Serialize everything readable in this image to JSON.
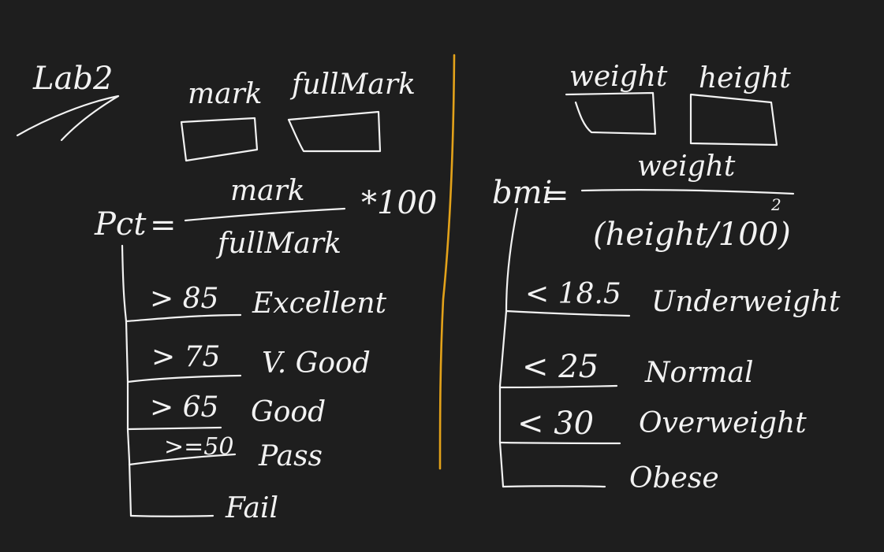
{
  "colors": {
    "background": "#1e1e1e",
    "ink": "#f2f2f2",
    "divider": "#e3a21a"
  },
  "title": "Lab2",
  "left": {
    "inputs": [
      "mark",
      "fullMark"
    ],
    "formula": {
      "lhs": "Pct",
      "eq": "=",
      "numerator": "mark",
      "denominator": "fullMark",
      "multiplier": "*100"
    },
    "branches": [
      {
        "condition": "> 85",
        "result": "Excellent"
      },
      {
        "condition": "> 75",
        "result": "V. Good"
      },
      {
        "condition": "> 65",
        "result": "Good"
      },
      {
        "condition": ">=50",
        "result": "Pass"
      },
      {
        "condition": "",
        "result": "Fail"
      }
    ]
  },
  "right": {
    "inputs": [
      "weight",
      "height"
    ],
    "formula": {
      "lhs": "bmi",
      "eq": "=",
      "numerator": "weight",
      "denominator": "(height/100)",
      "exponent": "2"
    },
    "branches": [
      {
        "condition": "< 18.5",
        "result": "Underweight"
      },
      {
        "condition": "< 25",
        "result": "Normal"
      },
      {
        "condition": "< 30",
        "result": "Overweight"
      },
      {
        "condition": "",
        "result": "Obese"
      }
    ]
  }
}
